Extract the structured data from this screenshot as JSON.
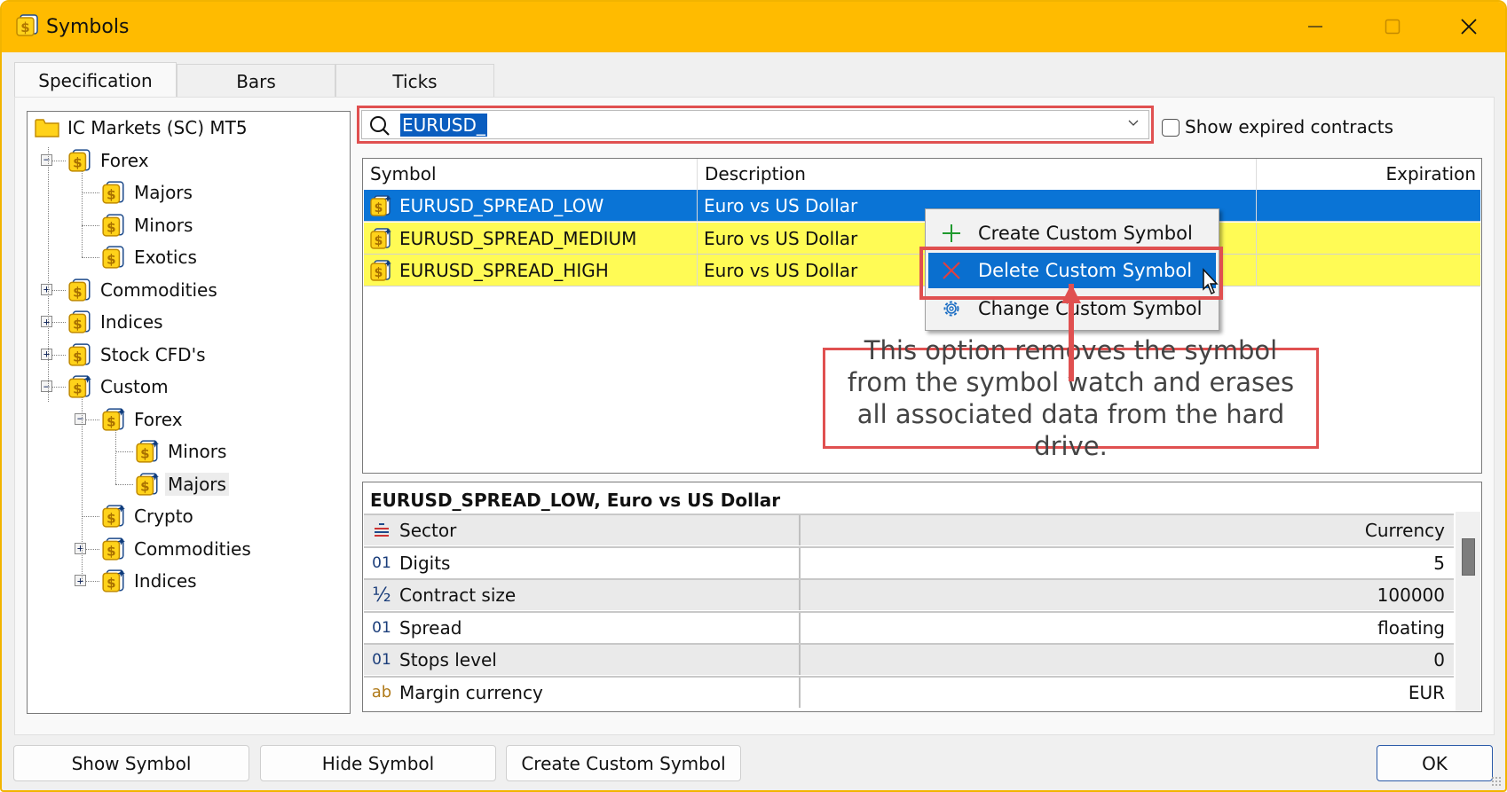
{
  "window": {
    "title": "Symbols",
    "controls": {
      "minimize": "minimize",
      "maximize": "maximize",
      "close": "close"
    }
  },
  "tabs": [
    {
      "label": "Specification",
      "active": true
    },
    {
      "label": "Bars",
      "active": false
    },
    {
      "label": "Ticks",
      "active": false
    }
  ],
  "tree": {
    "root": "IC Markets (SC) MT5",
    "items": [
      {
        "label": "Forex",
        "expander": "minus"
      },
      {
        "label": "Majors"
      },
      {
        "label": "Minors"
      },
      {
        "label": "Exotics"
      },
      {
        "label": "Commodities",
        "expander": "plus"
      },
      {
        "label": "Indices",
        "expander": "plus"
      },
      {
        "label": "Stock CFD's",
        "expander": "plus"
      },
      {
        "label": "Custom",
        "expander": "minus"
      },
      {
        "label": "Forex",
        "expander": "minus"
      },
      {
        "label": "Minors"
      },
      {
        "label": "Majors",
        "hovered": true
      },
      {
        "label": "Crypto"
      },
      {
        "label": "Commodities",
        "expander": "plus"
      },
      {
        "label": "Indices",
        "expander": "plus"
      }
    ]
  },
  "search": {
    "value": "EURUSD_",
    "show_expired_label": "Show expired contracts",
    "show_expired_checked": false
  },
  "symbols_table": {
    "columns": [
      "Symbol",
      "Description",
      "Expiration"
    ],
    "rows": [
      {
        "symbol": "EURUSD_SPREAD_LOW",
        "description": "Euro vs US Dollar",
        "expiration": "",
        "state": "selected"
      },
      {
        "symbol": "EURUSD_SPREAD_MEDIUM",
        "description": "Euro vs US Dollar",
        "expiration": "",
        "state": "custom"
      },
      {
        "symbol": "EURUSD_SPREAD_HIGH",
        "description": "Euro vs US Dollar",
        "expiration": "",
        "state": "custom"
      }
    ]
  },
  "context_menu": {
    "items": [
      {
        "label": "Create Custom Symbol",
        "icon": "plus-icon"
      },
      {
        "label": "Delete Custom Symbol",
        "icon": "x-icon",
        "active": true
      },
      {
        "label": "Change Custom Symbol",
        "icon": "gear-icon"
      }
    ]
  },
  "annotation": {
    "text": "This option removes the symbol from the symbol watch and erases all associated data from the hard drive."
  },
  "details": {
    "title": "EURUSD_SPREAD_LOW, Euro vs US Dollar",
    "rows": [
      {
        "icon": "sector-icon",
        "name": "Sector",
        "value": "Currency"
      },
      {
        "icon": "01",
        "name": "Digits",
        "value": "5"
      },
      {
        "icon": "½",
        "name": "Contract size",
        "value": "100000"
      },
      {
        "icon": "01",
        "name": "Spread",
        "value": "floating"
      },
      {
        "icon": "01",
        "name": "Stops level",
        "value": "0"
      },
      {
        "icon": "ab",
        "name": "Margin currency",
        "value": "EUR"
      }
    ]
  },
  "buttons": {
    "show_symbol": "Show Symbol",
    "hide_symbol": "Hide Symbol",
    "create_custom_symbol": "Create Custom Symbol",
    "ok": "OK"
  },
  "colors": {
    "titlebar": "#ffbb00",
    "selection": "#0a74d6",
    "custom_row": "#fffb55",
    "highlight_box": "#e05050"
  }
}
